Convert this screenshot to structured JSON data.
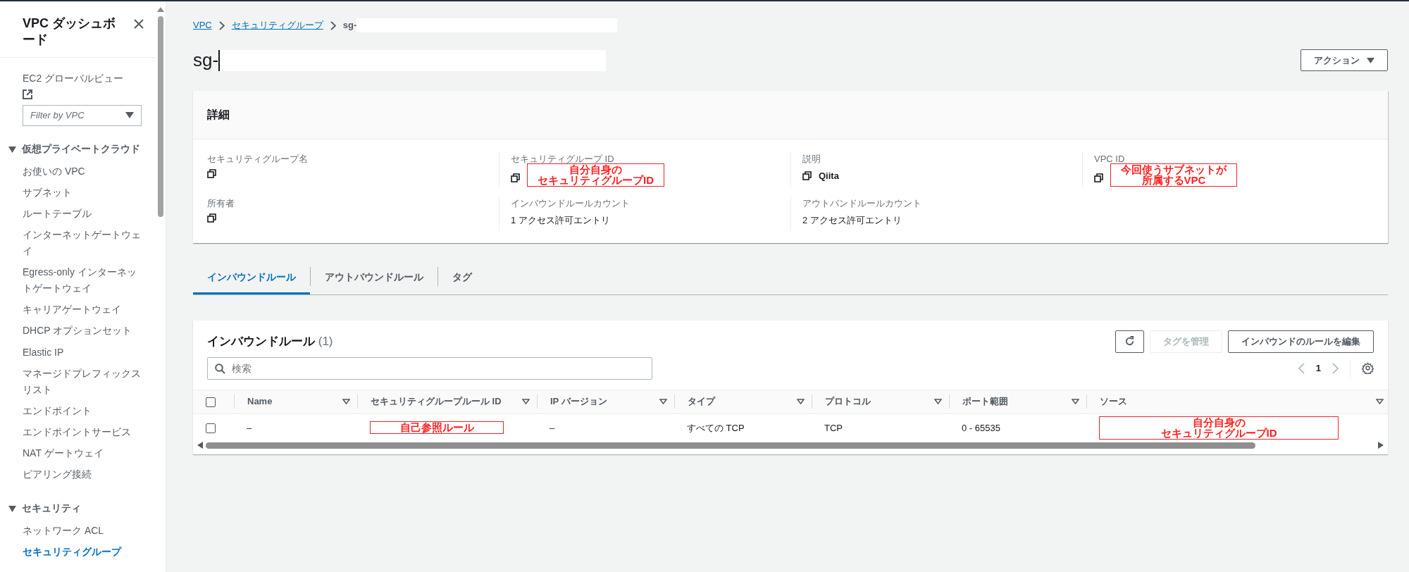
{
  "sidebar": {
    "title": "VPC ダッシュボード",
    "global_view_link": "EC2 グローバルビュー",
    "filter": {
      "placeholder": "Filter by VPC"
    },
    "sections": [
      {
        "title": "仮想プライベートクラウド",
        "expanded": true,
        "items": [
          {
            "label": "お使いの VPC",
            "selected": false
          },
          {
            "label": "サブネット",
            "selected": false
          },
          {
            "label": "ルートテーブル",
            "selected": false
          },
          {
            "label": "インターネットゲートウェイ",
            "selected": false
          },
          {
            "label": "Egress-only インターネットゲートウェイ",
            "selected": false
          },
          {
            "label": "キャリアゲートウェイ",
            "selected": false
          },
          {
            "label": "DHCP オプションセット",
            "selected": false
          },
          {
            "label": "Elastic IP",
            "selected": false
          },
          {
            "label": "マネージドプレフィックスリスト",
            "selected": false
          },
          {
            "label": "エンドポイント",
            "selected": false
          },
          {
            "label": "エンドポイントサービス",
            "selected": false
          },
          {
            "label": "NAT ゲートウェイ",
            "selected": false
          },
          {
            "label": "ピアリング接続",
            "selected": false
          }
        ]
      },
      {
        "title": "セキュリティ",
        "expanded": true,
        "items": [
          {
            "label": "ネットワーク ACL",
            "selected": false
          },
          {
            "label": "セキュリティグループ",
            "selected": true
          }
        ]
      }
    ]
  },
  "breadcrumb": [
    {
      "label": "VPC",
      "link": true
    },
    {
      "label": "セキュリティグループ",
      "link": true
    },
    {
      "label": "sg-",
      "link": false
    }
  ],
  "page_title": "sg-",
  "actions_button": "アクション",
  "details": {
    "title": "詳細",
    "fields": [
      {
        "label": "セキュリティグループ名",
        "copyable": true
      },
      {
        "label": "セキュリティグループ ID",
        "copyable": true,
        "annotation": [
          "自分自身の",
          "セキュリティグループID"
        ]
      },
      {
        "label": "説明",
        "copyable": true,
        "value": "Qiita"
      },
      {
        "label": "VPC ID",
        "copyable": true,
        "annotation": [
          "今回使うサブネットが",
          "所属するVPC"
        ]
      },
      {
        "label": "所有者",
        "copyable": true
      },
      {
        "label": "インバウンドルールカウント",
        "copyable": false,
        "value": "1 アクセス許可エントリ"
      },
      {
        "label": "アウトバンドルールカウント",
        "copyable": false,
        "value": "2 アクセス許可エントリ"
      }
    ]
  },
  "tabs": [
    {
      "label": "インバウンドルール",
      "selected": true
    },
    {
      "label": "アウトバウンドルール",
      "selected": false
    },
    {
      "label": "タグ",
      "selected": false
    }
  ],
  "rules_panel": {
    "title": "インバウンドルール",
    "count": "(1)",
    "buttons": [
      {
        "kind": "refresh",
        "disabled": false
      },
      {
        "kind": "text",
        "label": "タグを管理",
        "disabled": true
      },
      {
        "kind": "text",
        "label": "インバウンドのルールを編集",
        "disabled": false
      }
    ],
    "search": {
      "placeholder": "検索"
    },
    "page": "1",
    "all_selected": false,
    "columns": [
      "Name",
      "セキュリティグループルール ID",
      "IP バージョン",
      "タイプ",
      "プロトコル",
      "ポート範囲",
      "ソース"
    ],
    "rows": [
      {
        "selected": false,
        "cells": [
          "–",
          {
            "annotation": [
              "自己参照ルール"
            ]
          },
          "–",
          "すべての TCP",
          "TCP",
          "0 - 65535",
          {
            "annotation": [
              "自分自身の",
              "セキュリティグループID"
            ]
          }
        ]
      }
    ]
  }
}
